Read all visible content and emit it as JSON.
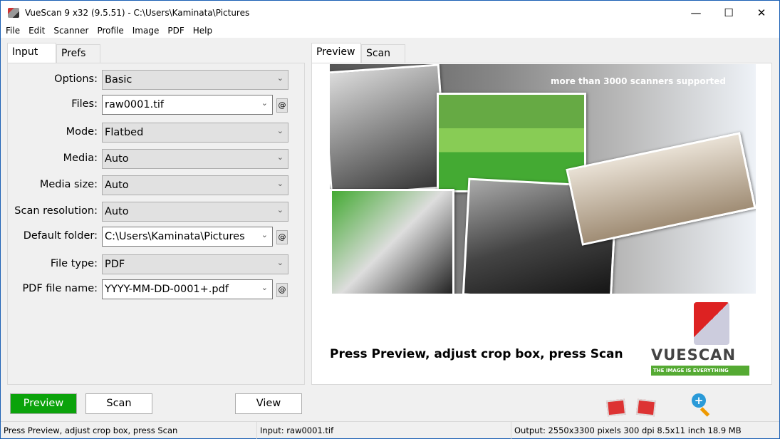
{
  "window": {
    "title": "VueScan 9 x32 (9.5.51) - C:\\Users\\Kaminata\\Pictures",
    "minimize": "—",
    "maximize": "☐",
    "close": "✕"
  },
  "menu": [
    "File",
    "Edit",
    "Scanner",
    "Profile",
    "Image",
    "PDF",
    "Help"
  ],
  "left_tabs": [
    "Input",
    "Prefs"
  ],
  "right_tabs": [
    "Preview",
    "Scan"
  ],
  "form": [
    {
      "label": "Options:",
      "value": "Basic",
      "editable": false,
      "at": false
    },
    {
      "label": "Files:",
      "value": "raw0001.tif",
      "editable": true,
      "at": true
    },
    {
      "label": "Mode:",
      "value": "Flatbed",
      "editable": false,
      "at": false
    },
    {
      "label": "Media:",
      "value": "Auto",
      "editable": false,
      "at": false
    },
    {
      "label": "Media size:",
      "value": "Auto",
      "editable": false,
      "at": false
    },
    {
      "label": "Scan resolution:",
      "value": "Auto",
      "editable": false,
      "at": false
    },
    {
      "label": "Default folder:",
      "value": "C:\\Users\\Kaminata\\Pictures",
      "editable": true,
      "at": true
    },
    {
      "label": "File type:",
      "value": "PDF",
      "editable": false,
      "at": false
    },
    {
      "label": "PDF file name:",
      "value": "YYYY-MM-DD-0001+.pdf",
      "editable": true,
      "at": true
    }
  ],
  "at_label": "@",
  "preview": {
    "banner": "more than 3000 scanners supported",
    "instruction": "Press Preview, adjust crop box, press Scan",
    "logo_text": "VUESCAN",
    "logo_tagline": "THE IMAGE IS EVERYTHING"
  },
  "buttons": {
    "preview": "Preview",
    "scan": "Scan",
    "view": "View"
  },
  "colors": {
    "preview_button": "#0ba30b",
    "window_border": "#1a5fb4"
  },
  "status": {
    "left": "Press Preview, adjust crop box, press Scan",
    "middle": "Input: raw0001.tif",
    "right": "Output: 2550x3300 pixels 300 dpi 8.5x11 inch 18.9 MB"
  }
}
